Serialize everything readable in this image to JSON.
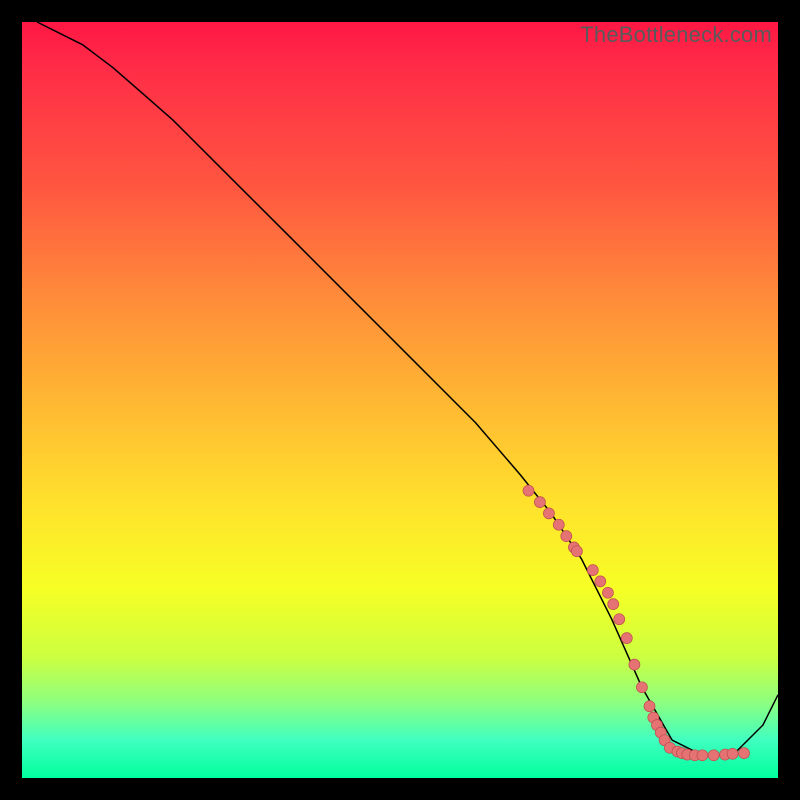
{
  "watermark": "TheBottleneck.com",
  "chart_data": {
    "type": "line",
    "title": "",
    "xlabel": "",
    "ylabel": "",
    "xlim": [
      0,
      100
    ],
    "ylim": [
      0,
      100
    ],
    "grid": false,
    "legend": false,
    "series": [
      {
        "name": "curve",
        "style": "line",
        "color": "#000000",
        "x": [
          2,
          4,
          8,
          12,
          16,
          20,
          28,
          36,
          44,
          52,
          60,
          66,
          70,
          74,
          78,
          82,
          86,
          90,
          94,
          98,
          100
        ],
        "y": [
          100,
          99,
          97,
          94,
          90.5,
          87,
          79,
          71,
          63,
          55,
          47,
          40,
          35,
          29,
          21,
          12,
          5,
          3,
          3,
          7,
          11
        ]
      },
      {
        "name": "markers",
        "style": "scatter",
        "color": "#e57373",
        "x": [
          67,
          68.5,
          69.7,
          71,
          72,
          73,
          73.4,
          75.5,
          76.5,
          77.5,
          78.2,
          79,
          80,
          81,
          82,
          83,
          83.5,
          84,
          84.5,
          85,
          85.7,
          86.7,
          87.3,
          88,
          89,
          90,
          91.5,
          93,
          94,
          95.5
        ],
        "y": [
          38,
          36.5,
          35,
          33.5,
          32,
          30.5,
          30,
          27.5,
          26,
          24.5,
          23,
          21,
          18.5,
          15,
          12,
          9.5,
          8,
          7,
          6,
          5,
          4,
          3.5,
          3.3,
          3.1,
          3,
          3,
          3,
          3.1,
          3.2,
          3.3
        ]
      }
    ]
  }
}
